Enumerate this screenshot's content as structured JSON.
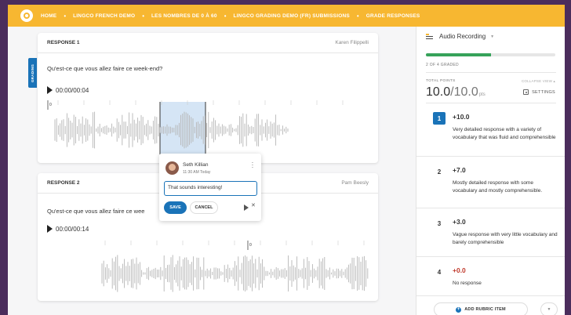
{
  "nav": {
    "breadcrumbs": [
      "HOME",
      "LINGCO FRENCH DEMO",
      "LES NOMBRES DE 0 À 60",
      "LINGCO GRADING DEMO (FR) SUBMISSIONS",
      "GRADE RESPONSES"
    ]
  },
  "grading_tab": {
    "label": "GRADING"
  },
  "responses": [
    {
      "title": "RESPONSE 1",
      "student": "Karen Filippelli",
      "prompt": "Qu'est-ce que vous allez faire ce week-end?",
      "time": "00:00/00:04",
      "marker": "0"
    },
    {
      "title": "RESPONSE 2",
      "student": "Pam Beesly",
      "prompt": "Qu'est-ce que vous allez faire ce wee",
      "time": "00:00/00:14",
      "marker": "0"
    }
  ],
  "comment": {
    "author": "Seth Killian",
    "time": "11:30 AM Today",
    "text": "That sounds interesting!",
    "save_label": "SAVE",
    "cancel_label": "CANCEL"
  },
  "sidebar": {
    "mode": "Audio Recording",
    "graded": "2 OF 4 GRADED",
    "graded_fraction": 0.5,
    "total_points_label": "TOTAL POINTS",
    "collapse_label": "COLLAPSE VIEW",
    "points_value": "10.0",
    "points_total": "/10.0",
    "points_unit": "pts",
    "settings_label": "SETTINGS",
    "rubric": [
      {
        "num": "1",
        "points": "+10.0",
        "desc": "Very detailed response with a variety of vocabulary that was fluid and comprehensible",
        "selected": true
      },
      {
        "num": "2",
        "points": "+7.0",
        "desc": "Mostly detailed response with some vocabulary and mostly comprehensible.",
        "selected": false
      },
      {
        "num": "3",
        "points": "+3.0",
        "desc": "Vague response with very little vocabulary and barely comprehensible",
        "selected": false
      },
      {
        "num": "4",
        "points": "+0.0",
        "desc": "No response",
        "selected": false
      }
    ],
    "add_label": "ADD RUBRIC ITEM"
  },
  "colors": {
    "accent": "#f7b731",
    "primary": "#1a73b8",
    "progress": "#36a25a",
    "background": "#4b2d5c"
  }
}
